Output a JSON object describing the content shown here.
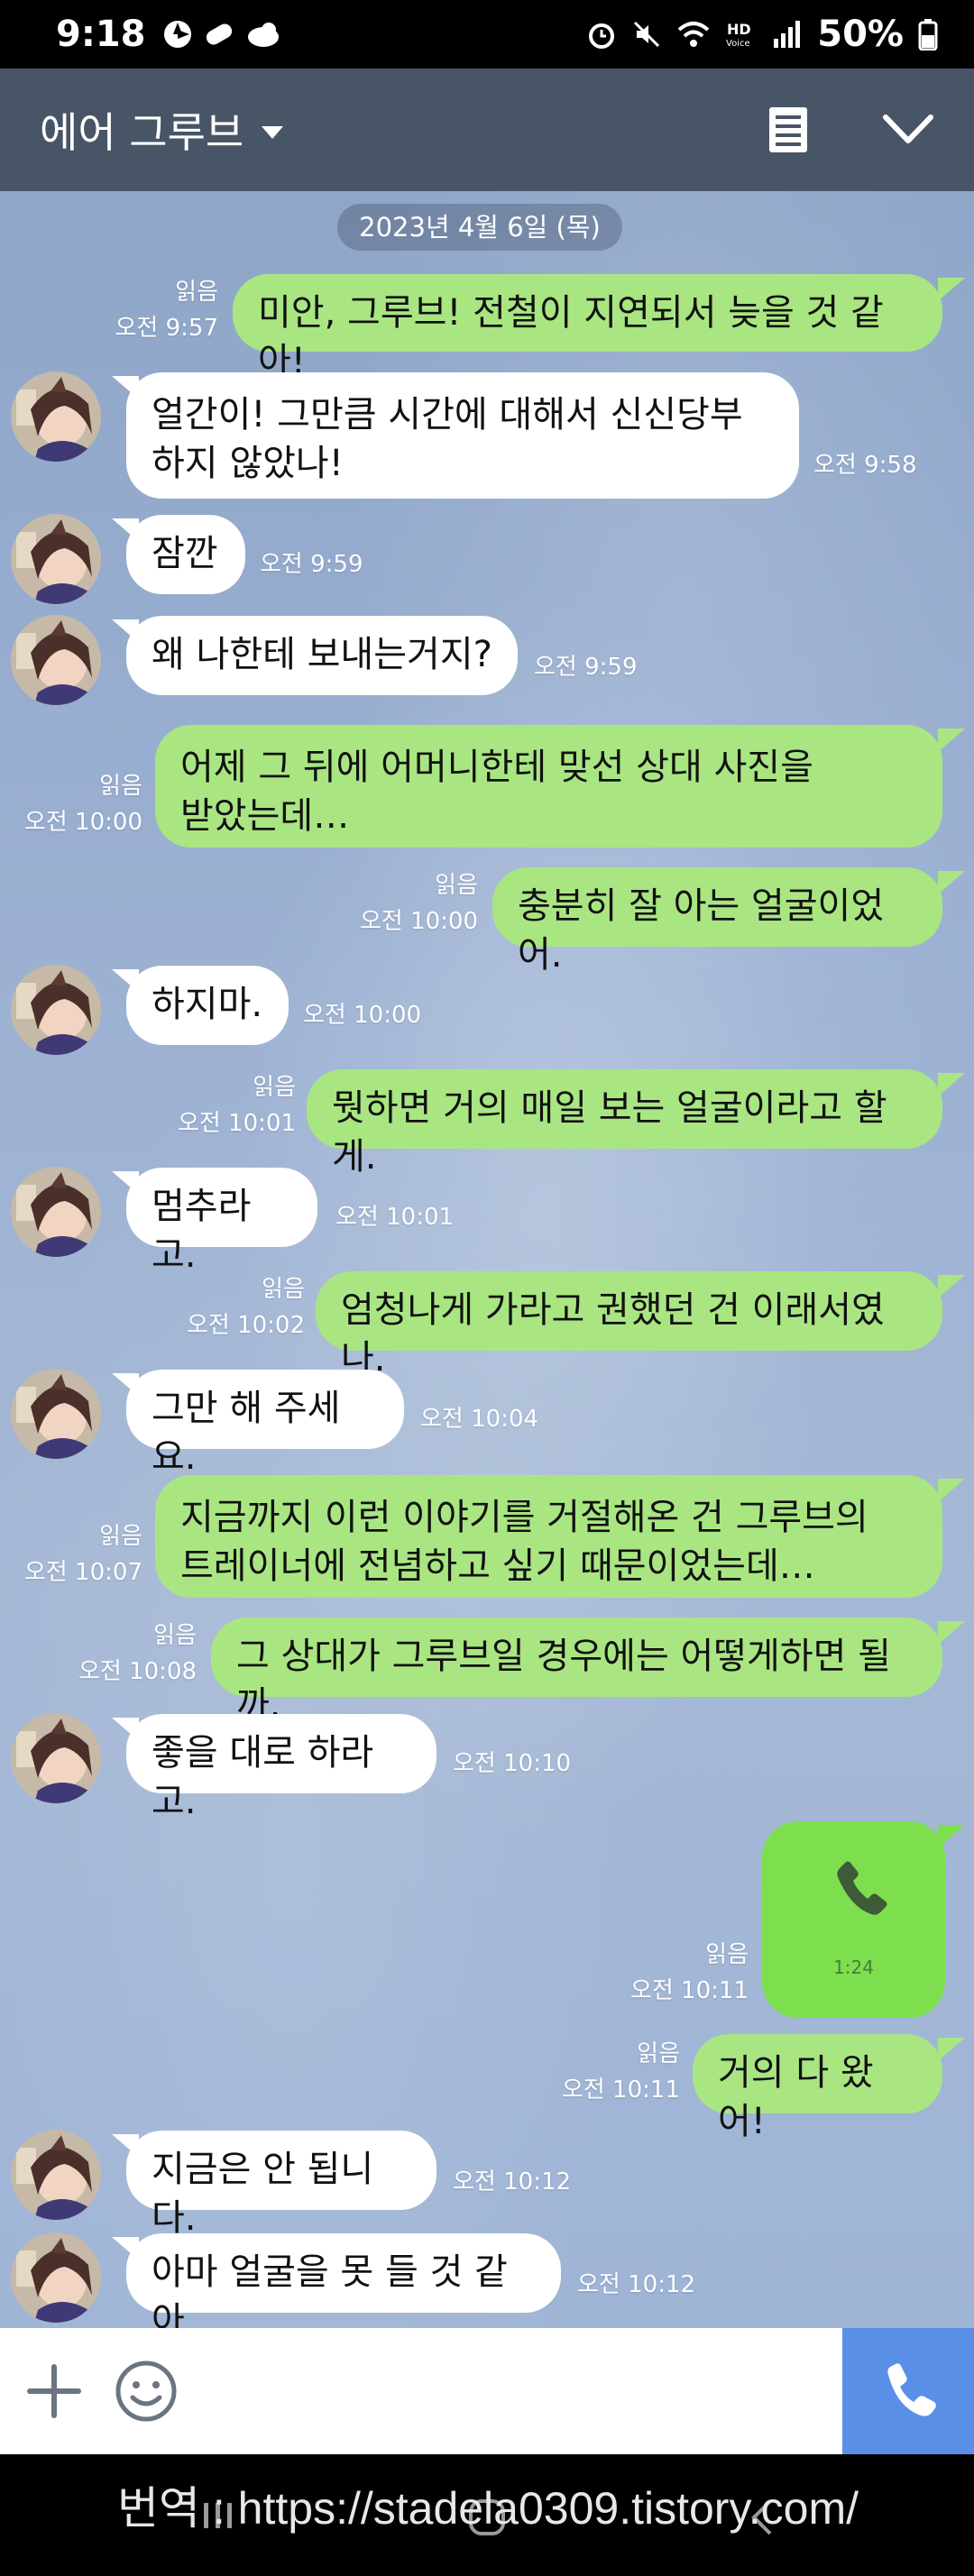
{
  "status_bar": {
    "time": "9:18",
    "battery": "50%"
  },
  "header": {
    "title": "에어 그루브",
    "icons": [
      "caret-down-icon",
      "notes-icon",
      "chevron-down-icon"
    ]
  },
  "date_divider": "2023년 4월 6일 (목)",
  "messages": [
    {
      "dir": "out",
      "text": "미안, 그루브! 전철이 지연되서 늦을 것 같아!",
      "read": "읽음",
      "time": "오전 9:57"
    },
    {
      "dir": "in",
      "text": "얼간이! 그만큼 시간에 대해서 신신당부\n하지 않았나!",
      "time": "오전 9:58"
    },
    {
      "dir": "in",
      "text": "잠깐",
      "time": "오전 9:59"
    },
    {
      "dir": "in",
      "text": "왜 나한테 보내는거지?",
      "time": "오전 9:59"
    },
    {
      "dir": "out",
      "text": "어제 그 뒤에 어머니한테 맞선 상대 사진을\n받았는데…",
      "read": "읽음",
      "time": "오전 10:00"
    },
    {
      "dir": "out",
      "text": "충분히 잘 아는 얼굴이었어.",
      "read": "읽음",
      "time": "오전 10:00"
    },
    {
      "dir": "in",
      "text": "하지마.",
      "time": "오전 10:00"
    },
    {
      "dir": "out",
      "text": "뭣하면 거의 매일 보는 얼굴이라고 할게.",
      "read": "읽음",
      "time": "오전 10:01"
    },
    {
      "dir": "in",
      "text": "멈추라고.",
      "time": "오전 10:01"
    },
    {
      "dir": "out",
      "text": "엄청나게 가라고 권했던 건 이래서였나.",
      "read": "읽음",
      "time": "오전 10:02"
    },
    {
      "dir": "in",
      "text": "그만 해 주세요.",
      "time": "오전 10:04"
    },
    {
      "dir": "out",
      "text": "지금까지 이런 이야기를 거절해온 건 그루브의\n트레이너에 전념하고 싶기 때문이었는데…",
      "read": "읽음",
      "time": "오전 10:07"
    },
    {
      "dir": "out",
      "text": "그 상대가 그루브일 경우에는 어떻게하면 될까.",
      "read": "읽음",
      "time": "오전 10:08"
    },
    {
      "dir": "in",
      "text": "좋을 대로 하라고.",
      "time": "오전 10:10"
    },
    {
      "dir": "out",
      "type": "call",
      "duration": "1:24",
      "read": "읽음",
      "time": "오전 10:11"
    },
    {
      "dir": "out",
      "text": "거의 다 왔어!",
      "read": "읽음",
      "time": "오전 10:11"
    },
    {
      "dir": "in",
      "text": "지금은 안 됩니다.",
      "time": "오전 10:12"
    },
    {
      "dir": "in",
      "text": "아마 얼굴을 못 들 것 같아.",
      "time": "오전 10:12"
    }
  ],
  "input_bar": {
    "placeholder": "",
    "icons": [
      "plus-icon",
      "emoji-icon",
      "phone-icon"
    ]
  },
  "watermark": "번역 : https://stadela0309.tistory.com/",
  "colors": {
    "header_bg": "#485566",
    "chat_bg": "#9db2d3",
    "out_bubble": "#a9e682",
    "call_bubble": "#7ddf4e",
    "in_bubble": "#ffffff",
    "call_button": "#5a8fe8"
  }
}
